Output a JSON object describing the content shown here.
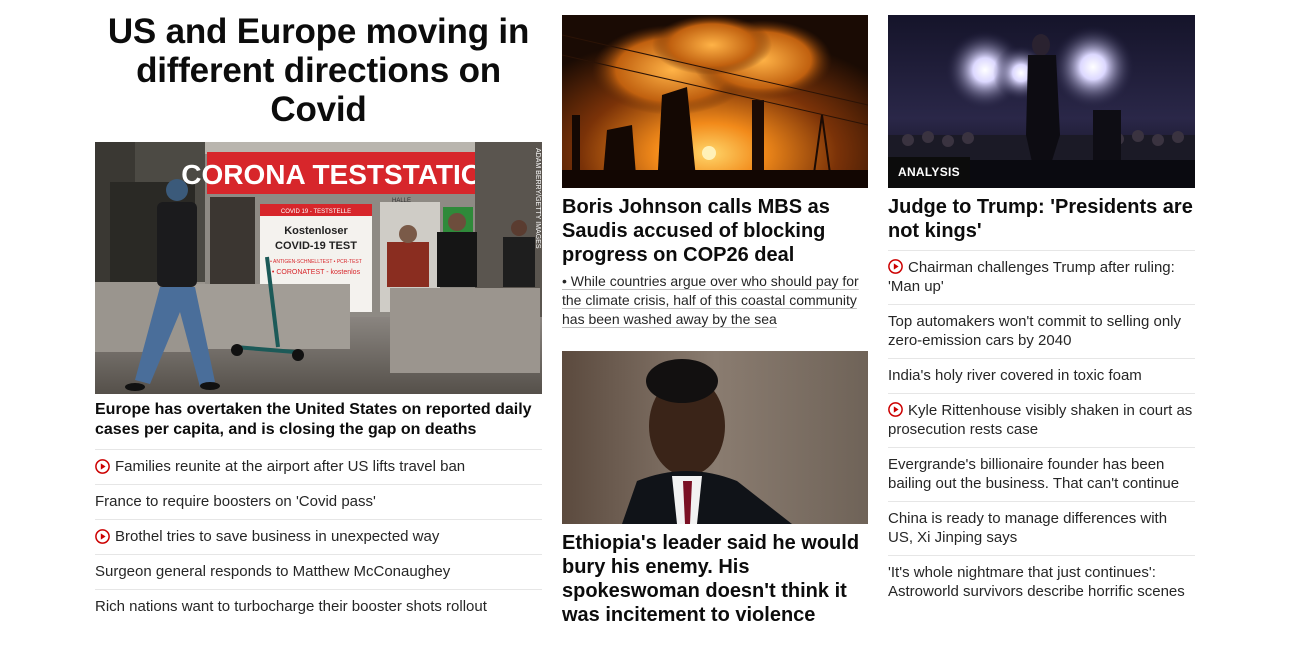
{
  "lead": {
    "title": "US and Europe moving in different directions on Covid",
    "image": {
      "sign_main": "CORONA TESTSTATION",
      "sign_sub1": "COVID 19 - TESTSTELLE",
      "sign_sub2": "Kostenloser",
      "sign_sub3": "COVID-19 TEST",
      "sign_sub4": "• ANTIGEN-SCHNELLTEST • PCR-TEST",
      "sign_sub5": "• CORONATEST - kostenlos",
      "sign_top": "HALLE",
      "credit": "ADAM BERRY/GETTY IMAGES"
    },
    "headline": "Europe has overtaken the United States on reported daily cases per capita, and is closing the gap on deaths",
    "items": [
      {
        "text": "Families reunite at the airport after US lifts travel ban",
        "video": true
      },
      {
        "text": "France to require boosters on 'Covid pass'",
        "video": false
      },
      {
        "text": "Brothel tries to save business in unexpected way",
        "video": true
      },
      {
        "text": "Surgeon general responds to Matthew McConaughey",
        "video": false
      },
      {
        "text": "Rich nations want to turbocharge their booster shots rollout",
        "video": false
      }
    ]
  },
  "middle": {
    "story1": {
      "headline": "Boris Johnson calls MBS as Saudis accused of blocking progress on COP26 deal",
      "sub": "• While countries argue over who should pay for the climate crisis, half of this coastal community has been washed away by the sea"
    },
    "story2": {
      "headline": "Ethiopia's leader said he would bury his enemy. His spokeswoman doesn't think it was incitement to violence"
    }
  },
  "right": {
    "badge": "ANALYSIS",
    "headline": "Judge to Trump: 'Presidents are not kings'",
    "items": [
      {
        "text": "Chairman challenges Trump after ruling: 'Man up'",
        "video": true
      },
      {
        "text": "Top automakers won't commit to selling only zero-emission cars by 2040",
        "video": false
      },
      {
        "text": "India's holy river covered in toxic foam",
        "video": false
      },
      {
        "text": "Kyle Rittenhouse visibly shaken in court as prosecution rests case",
        "video": true
      },
      {
        "text": "Evergrande's billionaire founder has been bailing out the business. That can't continue",
        "video": false
      },
      {
        "text": "China is ready to manage differences with US, Xi Jinping says",
        "video": false
      },
      {
        "text": "'It's whole nightmare that just continues': Astroworld survivors describe horrific scenes",
        "video": false
      }
    ]
  },
  "colors": {
    "play_icon": "#cc0000",
    "divider": "#e6e6e6",
    "headline": "#0c0c0c",
    "badge_bg": "#0c0c0c"
  }
}
